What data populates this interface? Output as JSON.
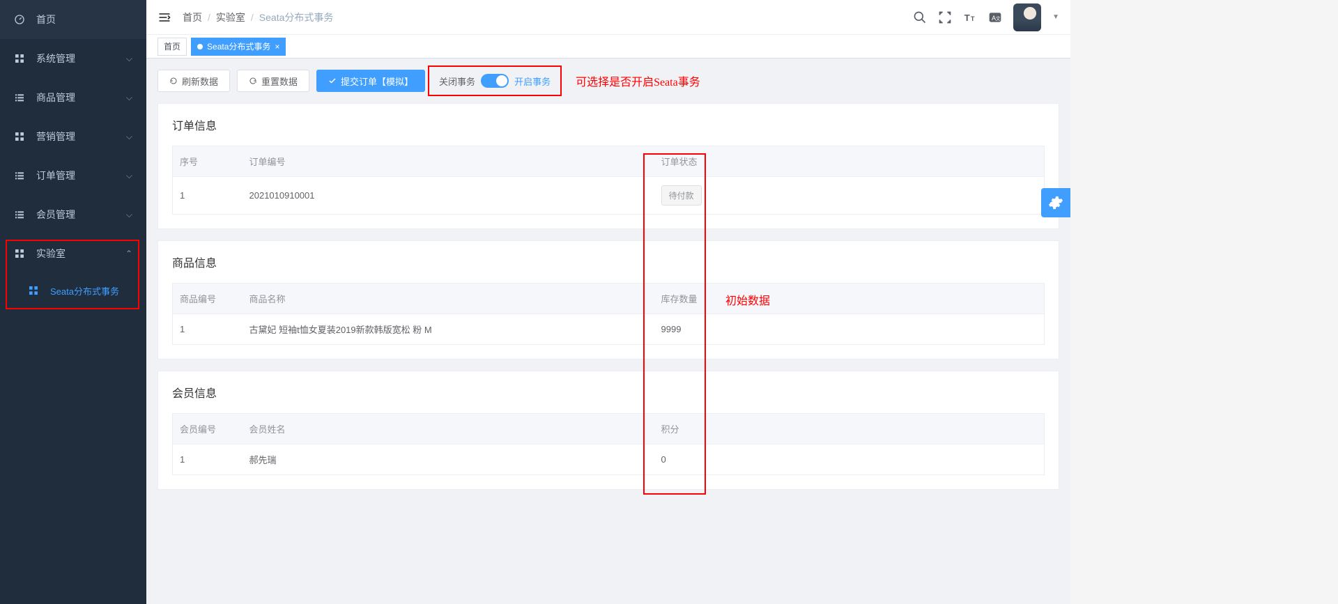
{
  "sidebar": {
    "items": [
      {
        "label": "首页",
        "icon": "dashboard"
      },
      {
        "label": "系统管理",
        "icon": "grid",
        "expandable": true
      },
      {
        "label": "商品管理",
        "icon": "list",
        "expandable": true
      },
      {
        "label": "营销管理",
        "icon": "grid",
        "expandable": true
      },
      {
        "label": "订单管理",
        "icon": "list",
        "expandable": true
      },
      {
        "label": "会员管理",
        "icon": "list",
        "expandable": true
      },
      {
        "label": "实验室",
        "icon": "grid",
        "expandable": true,
        "expanded": true
      }
    ],
    "sub": {
      "label": "Seata分布式事务"
    }
  },
  "breadcrumb": {
    "home": "首页",
    "lab": "实验室",
    "current": "Seata分布式事务"
  },
  "tabs": {
    "home": "首页",
    "active": "Seata分布式事务"
  },
  "toolbar": {
    "refresh": "刷新数据",
    "reset": "重置数据",
    "submit": "提交订单【模拟】",
    "switch_off": "关闭事务",
    "switch_on": "开启事务"
  },
  "annot": {
    "switch_note": "可选择是否开启Seata事务",
    "data_note": "初始数据"
  },
  "order": {
    "title": "订单信息",
    "headers": {
      "idx": "序号",
      "no": "订单编号",
      "status": "订单状态"
    },
    "row": {
      "idx": "1",
      "no": "2021010910001",
      "status": "待付款"
    }
  },
  "product": {
    "title": "商品信息",
    "headers": {
      "idx": "商品编号",
      "name": "商品名称",
      "stock": "库存数量"
    },
    "row": {
      "idx": "1",
      "name": "古黛妃 短袖t恤女夏装2019新款韩版宽松 粉 M",
      "stock": "9999"
    }
  },
  "member": {
    "title": "会员信息",
    "headers": {
      "idx": "会员编号",
      "name": "会员姓名",
      "points": "积分"
    },
    "row": {
      "idx": "1",
      "name": "郝先瑞",
      "points": "0"
    }
  }
}
